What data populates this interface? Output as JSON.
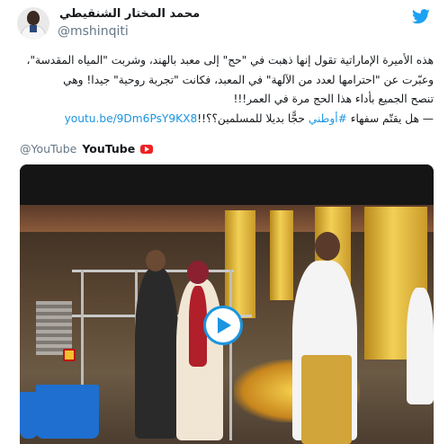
{
  "tweet": {
    "author_name": "محمد المختار الشنقيطي",
    "author_handle": "@mshinqiti",
    "icons": {
      "avatar": "profile-photo",
      "service": "twitter-bird-icon",
      "play": "play-icon",
      "card_brand": "youtube-icon"
    },
    "body_lines": [
      "هذه الأميرة الإماراتية تقول إنها ذهبت في \"حج\" إلى معبد بالهند، وشربت \"المياه المقدسة\"،",
      "وعبّرت عن \"احترامها لعدد من الآلهة\" في المعبد، فكانت \"تجربة روحية\" جيدا! وهي",
      "تنصح الجميع بأداء هذا الحج مرة في العمر!!!"
    ],
    "link_text": "youtu.be/9Dm6PsY9KX8",
    "last_line_prefix": "— هل يقتّم سفهاء ",
    "hashtag": "#أوطني",
    "last_line_suffix": " حجًّا بديلا للمسلمين؟؟!!"
  },
  "card": {
    "source_handle": "@YouTube",
    "source_name": "YouTube"
  },
  "colors": {
    "link": "#1b95e0",
    "text": "#14171a",
    "muted": "#657786",
    "bird": "#1da1f2",
    "youtube_red": "#e22222"
  }
}
